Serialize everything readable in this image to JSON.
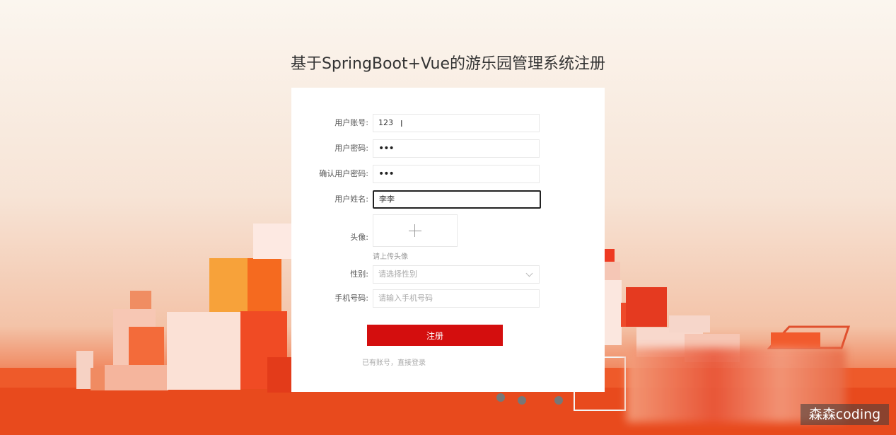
{
  "page": {
    "title": "基于SpringBoot+Vue的游乐园管理系统注册"
  },
  "form": {
    "account": {
      "label": "用户账号:",
      "value": "123"
    },
    "password": {
      "label": "用户密码:",
      "value": "•••"
    },
    "confirm_password": {
      "label": "确认用户密码:",
      "value": "•••"
    },
    "name": {
      "label": "用户姓名:",
      "value": "李李"
    },
    "avatar": {
      "label": "头像:",
      "hint": "请上传头像"
    },
    "gender": {
      "label": "性别:",
      "placeholder": "请选择性别"
    },
    "phone": {
      "label": "手机号码:",
      "placeholder": "请输入手机号码"
    },
    "submit_label": "注册",
    "login_link": "已有账号，直接登录"
  },
  "watermark": "森森coding",
  "colors": {
    "accent": "#d40e0e",
    "background_orange": "#e8481c"
  }
}
